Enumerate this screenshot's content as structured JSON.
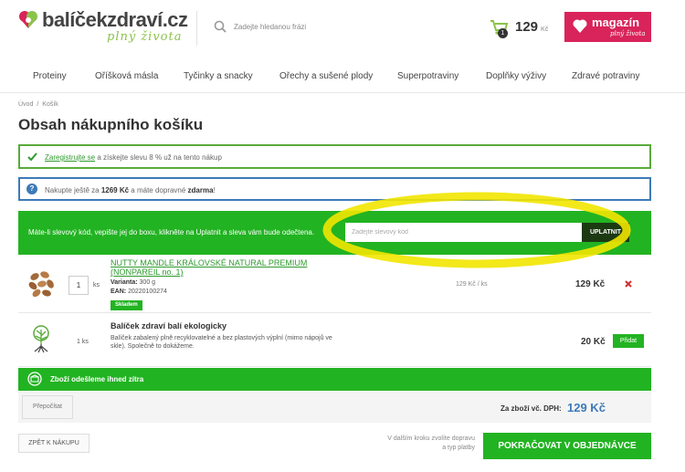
{
  "header": {
    "logo_name": "balíčekzdraví.cz",
    "logo_tagline": "plný života",
    "search_placeholder": "Zadejte hledanou frázi",
    "cart_count": "1",
    "cart_total": "129",
    "cart_currency": "Kč",
    "magazin_label": "magazín",
    "magazin_sub": "plný života"
  },
  "nav": {
    "items": [
      "Proteiny",
      "Oříšková másla",
      "Tyčinky a snacky",
      "Ořechy a sušené plody",
      "Superpotraviny",
      "Doplňky výživy",
      "Zdravé potraviny"
    ]
  },
  "breadcrumb": {
    "home": "Úvod",
    "sep": "/",
    "current": "Košík"
  },
  "page_title": "Obsah nákupního košíku",
  "register_box": {
    "link": "Zaregistrujte se",
    "text": " a získejte slevu 8 % už na tento nákup"
  },
  "ship_box": {
    "pre": "Nakupte ještě za ",
    "amount": "1269 Kč",
    "mid": " a máte dopravné ",
    "free": "zdarma",
    "end": "!"
  },
  "discount": {
    "text": "Máte-li slevový kód, vepište jej do boxu, klikněte na Uplatnit a sleva vám bude odečtena.",
    "placeholder": "Zadejte slevový kód",
    "button": "UPLATNIT"
  },
  "products": [
    {
      "name": "NUTTY MANDLE KRÁLOVSKÉ NATURAL PREMIUM (NONPAREIL no. 1)",
      "qty": "1",
      "qty_unit": "ks",
      "variant_label": "Varianta:",
      "variant": "300 g",
      "ean_label": "EAN:",
      "ean": "20220100274",
      "stock": "Skladem",
      "unit_price": "129 Kč / ks",
      "price": "129 Kč"
    },
    {
      "name": "Balíček zdraví balí ekologicky",
      "qty": "1",
      "qty_unit": "ks",
      "desc": "Balíček zabalený plně recyklovatelné a bez plastových výplní (mimo nápojů ve skle). Společně to dokážeme.",
      "price": "20 Kč",
      "add_label": "Přidat"
    }
  ],
  "shipping_bar": "Zboží odešleme ihned zítra",
  "totals": {
    "recalc": "Přepočítat",
    "label": "Za zboží vč. DPH:",
    "value": "129 Kč"
  },
  "bottom": {
    "back": "ZPĚT K NÁKUPU",
    "note": "V dalším kroku zvolíte dopravu a typ platby",
    "next": "POKRAČOVAT V OBJEDNÁVCE"
  },
  "colors": {
    "green": "#22b322",
    "blue": "#3d7ab8",
    "pink": "#d8245a",
    "highlight": "#f2e600"
  }
}
